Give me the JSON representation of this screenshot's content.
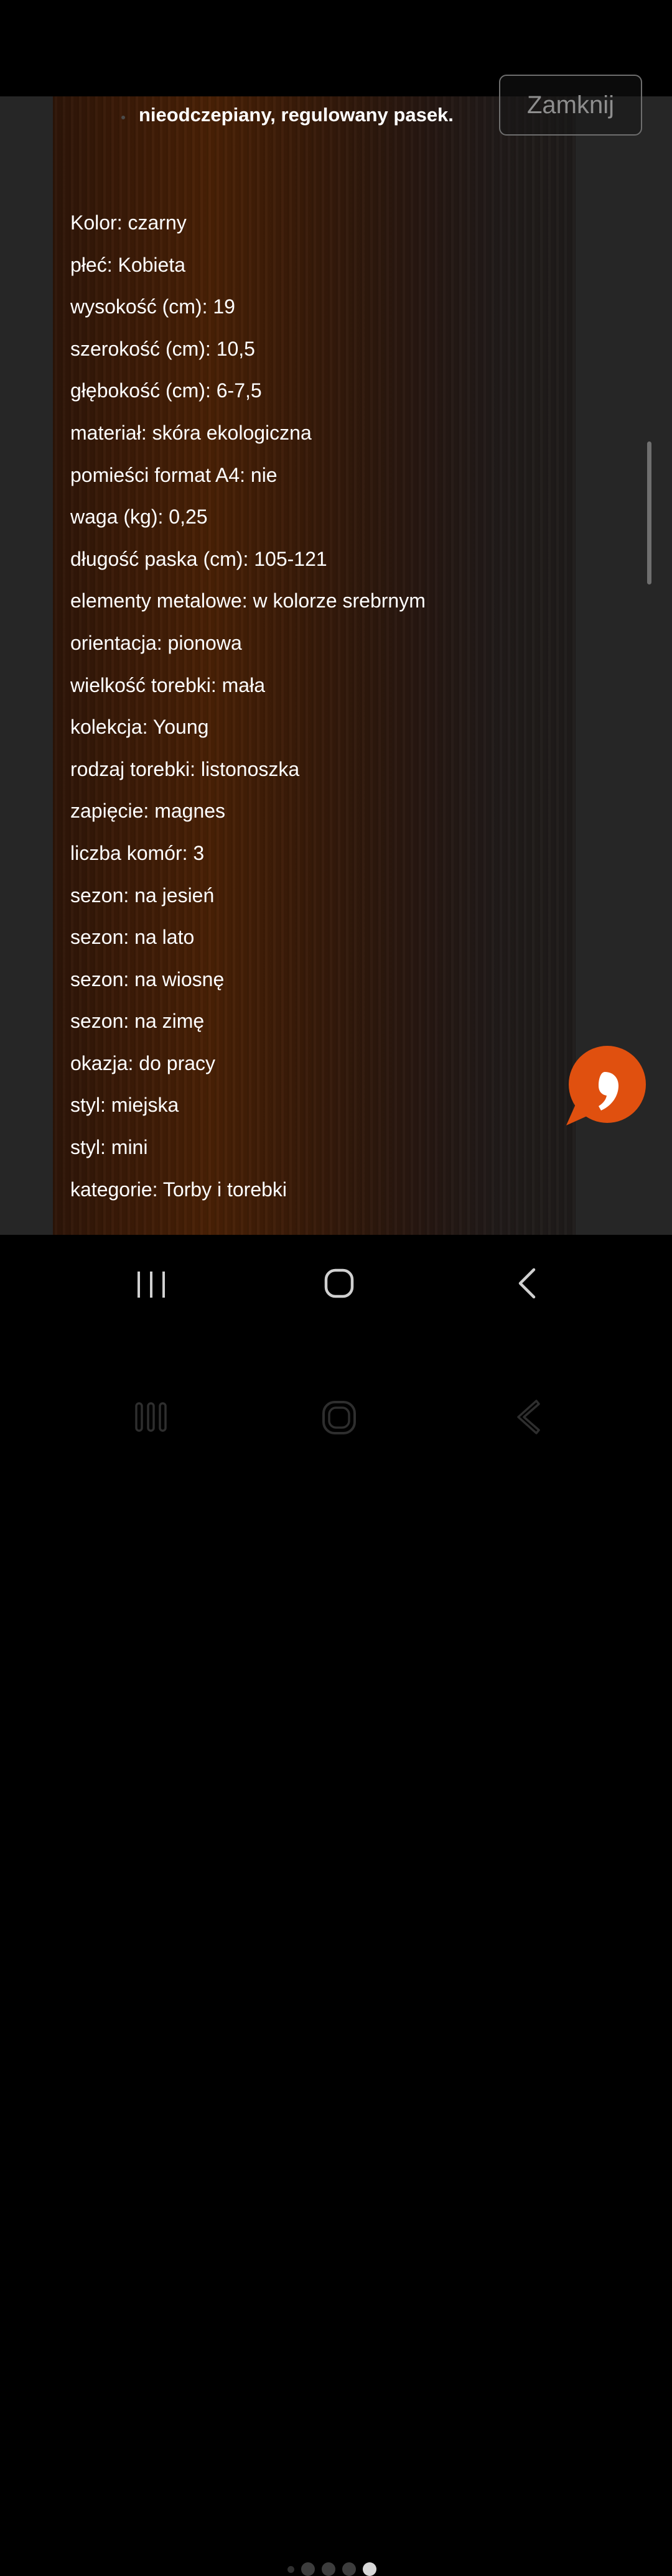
{
  "viewer": {
    "bullet_text": "nieodczepiany, regulowany pasek.",
    "close_label": "Zamknij",
    "specs": [
      "Kolor: czarny",
      "płeć: Kobieta",
      "wysokość (cm): 19",
      "szerokość (cm): 10,5",
      "głębokość (cm): 6-7,5",
      "materiał: skóra ekologiczna",
      "pomieści format A4: nie",
      "waga (kg): 0,25",
      "długość paska (cm): 105-121",
      "elementy metalowe: w kolorze srebrnym",
      "orientacja: pionowa",
      "wielkość torebki: mała",
      "kolekcja: Young",
      "rodzaj torebki: listonoszka",
      "zapięcie: magnes",
      "liczba komór: 3",
      "sezon: na jesień",
      "sezon: na lato",
      "sezon: na wiosnę",
      "sezon: na zimę",
      "okazja: do pracy",
      "styl: miejska",
      "styl: mini",
      "kategorie: Torby i torebki"
    ]
  },
  "chat_button": {
    "icon": "quote-chat-icon",
    "color": "#e0500f"
  },
  "pager": {
    "count": 5,
    "active_index": 4
  },
  "navigation": {
    "items": [
      "recent-apps-icon",
      "home-icon",
      "back-icon"
    ]
  }
}
